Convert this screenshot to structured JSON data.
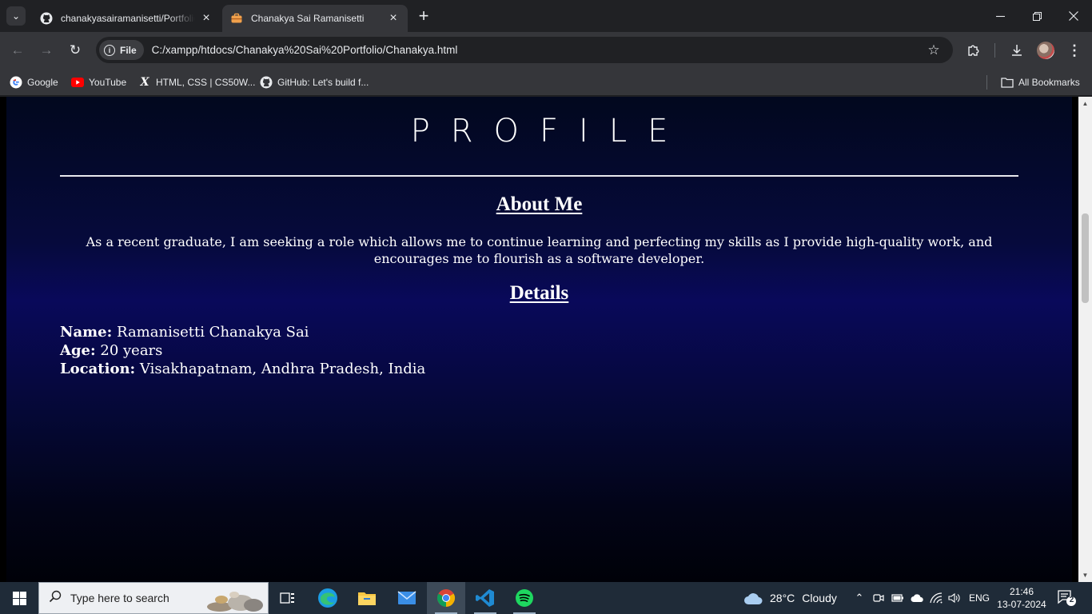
{
  "browser": {
    "tabs": [
      {
        "title": "chanakyasairamanisetti/Portfolio",
        "icon": "github-icon",
        "active": false
      },
      {
        "title": "Chanakya Sai Ramanisetti",
        "icon": "briefcase-icon",
        "active": true
      }
    ],
    "omnibox": {
      "chip_label": "File",
      "url": "C:/xampp/htdocs/Chanakya%20Sai%20Portfolio/Chanakya.html"
    },
    "bookmarks": [
      {
        "label": "Google",
        "icon": "google-icon"
      },
      {
        "label": "YouTube",
        "icon": "youtube-icon"
      },
      {
        "label": "HTML, CSS | CS50W...",
        "icon": "x-icon"
      },
      {
        "label": "GitHub: Let's build f...",
        "icon": "github-icon"
      }
    ],
    "all_bookmarks": "All Bookmarks"
  },
  "page": {
    "logo_text": "PROFILE",
    "about": {
      "heading": "About Me",
      "text": "As a recent graduate, I am seeking a role which allows me to continue learning and perfecting my skills as I provide high-quality work, and encourages me to flourish as a software developer."
    },
    "details": {
      "heading": "Details",
      "name_label": "Name:",
      "name_value": " Ramanisetti Chanakya Sai",
      "age_label": "Age:",
      "age_value": " 20 years",
      "location_label": "Location:",
      "location_value": " Visakhapatnam, Andhra Pradesh, India"
    }
  },
  "taskbar": {
    "search_placeholder": "Type here to search",
    "weather": {
      "temp": "28°C",
      "condition": "Cloudy"
    },
    "language": "ENG",
    "time": "21:46",
    "date": "13-07-2024",
    "notification_count": "2"
  },
  "colors": {
    "page_gradient_mid": "#09095a",
    "chrome_bg": "#202124",
    "toolbar_bg": "#35363a",
    "taskbar_bg": "#1f2b38"
  }
}
